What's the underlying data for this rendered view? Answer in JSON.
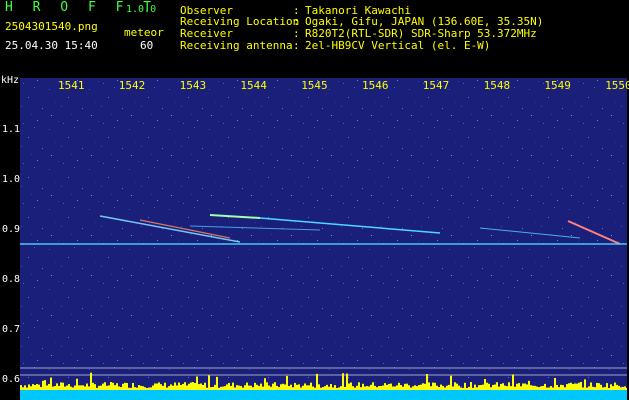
{
  "header": {
    "app_title": "H R O F F T",
    "version": "1.0.0",
    "file_name": "2504301540.png",
    "mode": "meteor",
    "datetime": "25.04.30 15:40",
    "count": "60"
  },
  "station_info": [
    {
      "label": "Observer",
      "value": "Takanori Kawachi"
    },
    {
      "label": "Receiving Location",
      "value": "Ogaki, Gifu, JAPAN (136.60E, 35.35N)"
    },
    {
      "label": "Receiver",
      "value": "R820T2(RTL-SDR) SDR-Sharp 53.372MHz"
    },
    {
      "label": "Receiving antenna",
      "value": "2el-HB9CV Vertical (el. E-W)"
    }
  ],
  "spectrogram": {
    "unit": "kHz",
    "time_ticks": [
      "1541",
      "1542",
      "1543",
      "1544",
      "1545",
      "1546",
      "1547",
      "1548",
      "1549",
      "1550"
    ],
    "freq_ticks": [
      "1.1",
      "1.0",
      "0.9",
      "0.8",
      "0.7",
      "0.6"
    ],
    "carrier_khz": 0.873,
    "colors": {
      "background": "#1a1f7a",
      "trace": "#4fd8ff",
      "hot": "#ff3040",
      "level_bar": "#ffff00",
      "baseline": "#00c8ff"
    }
  }
}
